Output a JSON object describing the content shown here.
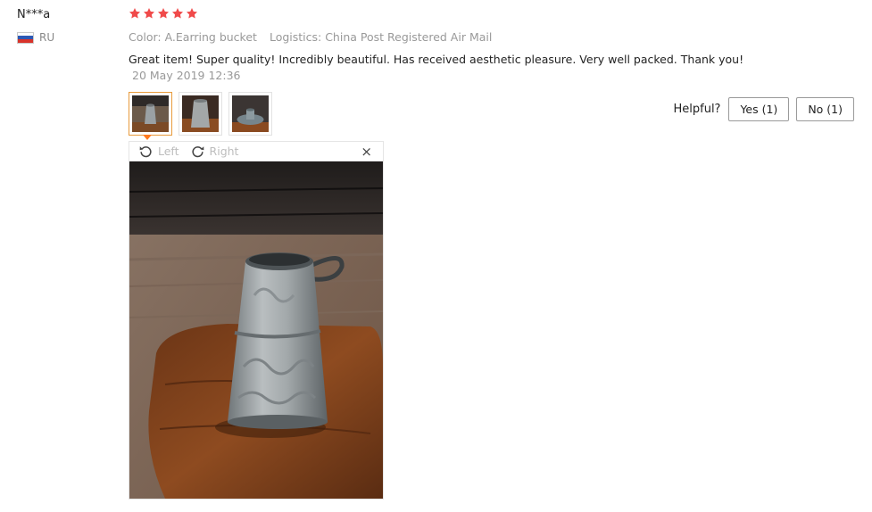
{
  "user": {
    "name": "N***a",
    "country": "RU"
  },
  "rating": {
    "stars": 5,
    "color": "#f04a4a"
  },
  "meta": {
    "color": "Color: A.Earring bucket",
    "logistics": "Logistics: China Post Registered Air Mail"
  },
  "review": {
    "text": "Great item! Super quality! Incredibly beautiful. Has received aesthetic pleasure. Very well packed. Thank you!",
    "date": "20 May 2019 12:36"
  },
  "helpful": {
    "label": "Helpful?",
    "yes_label": "Yes (1)",
    "no_label": "No (1)"
  },
  "viewer": {
    "left_label": "Left",
    "right_label": "Right",
    "close_icon": "×"
  },
  "thumbnails": [
    {
      "name": "bucket-front",
      "active": true
    },
    {
      "name": "bucket-detail",
      "active": false
    },
    {
      "name": "bucket-top",
      "active": false
    }
  ],
  "colors": {
    "accent": "#e89b3c",
    "caret": "#ff7a1f"
  }
}
